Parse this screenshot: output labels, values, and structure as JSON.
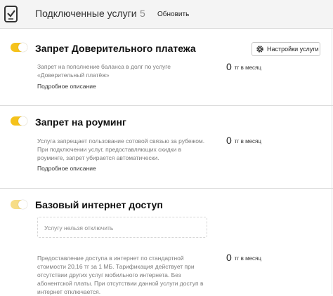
{
  "header": {
    "title": "Подключенные услуги",
    "count": "5",
    "refresh_label": "Обновить",
    "icon": "phone-check-icon"
  },
  "settings_button": {
    "label": "Настройки услуги",
    "icon": "gear-icon"
  },
  "services": [
    {
      "title": "Запрет Доверительного платежа",
      "enabled": true,
      "description": [
        "Запрет на пополнение баланса в долг по услуге",
        "«Доверительный платёж»"
      ],
      "more_label": "Подробное описание",
      "price": "0",
      "price_unit": "тг в месяц"
    },
    {
      "title": "Запрет на роуминг",
      "enabled": true,
      "description": [
        "Услуга запрещает пользование сотовой связью за рубежом.",
        "При подключении услуг, предоставляющих скидки в",
        "роуминге, запрет убирается автоматически."
      ],
      "more_label": "Подробное описание",
      "price": "0",
      "price_unit": "тг в месяц"
    },
    {
      "title": "Базовый интернет доступ",
      "enabled": true,
      "locked_note": "Услугу нельзя отключить",
      "description": [
        "Предоставление доступа в интернет по стандартной",
        "стоимости 20,16 тг за 1 МБ. Тарификация действует при",
        "отсутствии других услуг мобильного интернета. Без",
        "абонентской платы. При отсутствии данной услуги доступ в",
        "интернет отключается."
      ],
      "price": "0",
      "price_unit": "тг в месяц"
    }
  ],
  "colors": {
    "toggle_on": "#f5c21b",
    "toggle_disabled": "#f7dd86",
    "header_bg": "#f4f4f4"
  }
}
